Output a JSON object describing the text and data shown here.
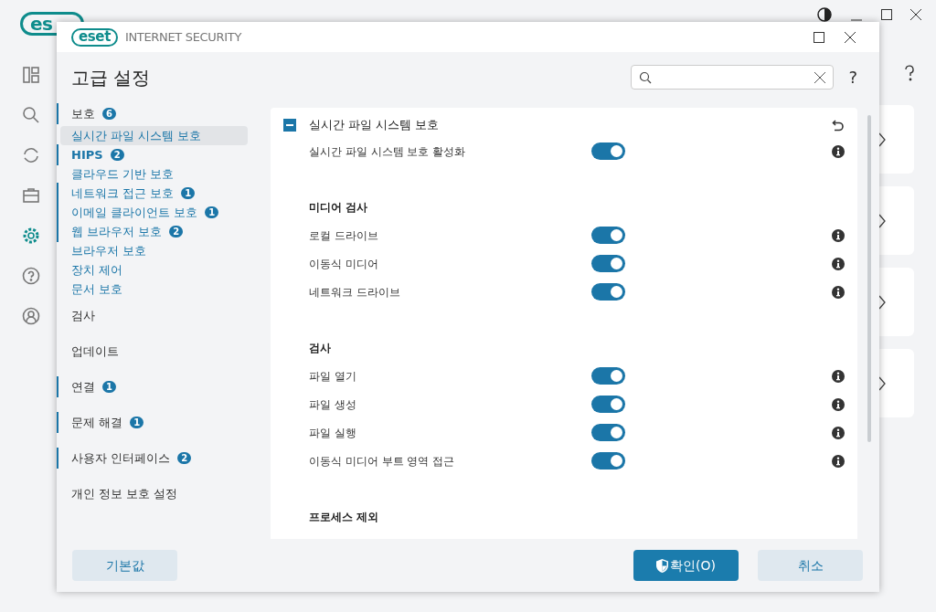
{
  "background_app": {
    "logo": "es"
  },
  "dialog": {
    "logo": "eset",
    "product": "INTERNET SECURITY",
    "title": "고급 설정",
    "help": "?",
    "sidebar": {
      "items": [
        {
          "label": "보호",
          "badge": "6",
          "selected": false,
          "children": [
            {
              "label": "실시간 파일 시스템 보호",
              "selected": true
            },
            {
              "label": "HIPS",
              "badge": "2",
              "selected": false
            },
            {
              "label": "클라우드 기반 보호",
              "selected": false
            },
            {
              "label": "네트워크 접근 보호",
              "badge": "1",
              "selected": false
            },
            {
              "label": "이메일 클라이언트 보호",
              "badge": "1",
              "selected": false
            },
            {
              "label": "웹 브라우저 보호",
              "badge": "2",
              "selected": false
            },
            {
              "label": "브라우저 보호",
              "selected": false
            },
            {
              "label": "장치 제어",
              "selected": false
            },
            {
              "label": "문서 보호",
              "selected": false
            }
          ]
        },
        {
          "label": "검사",
          "selected": false
        },
        {
          "label": "업데이트",
          "selected": false
        },
        {
          "label": "연결",
          "badge": "1",
          "selected": false
        },
        {
          "label": "문제 해결",
          "badge": "1",
          "selected": false
        },
        {
          "label": "사용자 인터페이스",
          "badge": "2",
          "selected": false
        },
        {
          "label": "개인 정보 보호 설정",
          "selected": false
        }
      ]
    },
    "section": {
      "title": "실시간 파일 시스템 보호",
      "expanded": true,
      "rows": [
        {
          "kind": "toggle",
          "label": "실시간 파일 시스템 보호 활성화",
          "on": true
        },
        {
          "kind": "heading",
          "label": "미디어 검사"
        },
        {
          "kind": "toggle",
          "label": "로컬 드라이브",
          "on": true
        },
        {
          "kind": "toggle",
          "label": "이동식 미디어",
          "on": true
        },
        {
          "kind": "toggle",
          "label": "네트워크 드라이브",
          "on": true
        },
        {
          "kind": "heading",
          "label": "검사"
        },
        {
          "kind": "toggle",
          "label": "파일 열기",
          "on": true
        },
        {
          "kind": "toggle",
          "label": "파일 생성",
          "on": true
        },
        {
          "kind": "toggle",
          "label": "파일 실행",
          "on": true
        },
        {
          "kind": "toggle",
          "label": "이동식 미디어 부트 영역 접근",
          "on": true
        },
        {
          "kind": "heading",
          "label": "프로세스 제외"
        }
      ]
    },
    "buttons": [
      {
        "kind": "secondary",
        "label": "기본값"
      },
      {
        "kind": "primary",
        "label": "확인(O)"
      },
      {
        "kind": "secondary",
        "label": "취소"
      }
    ]
  }
}
